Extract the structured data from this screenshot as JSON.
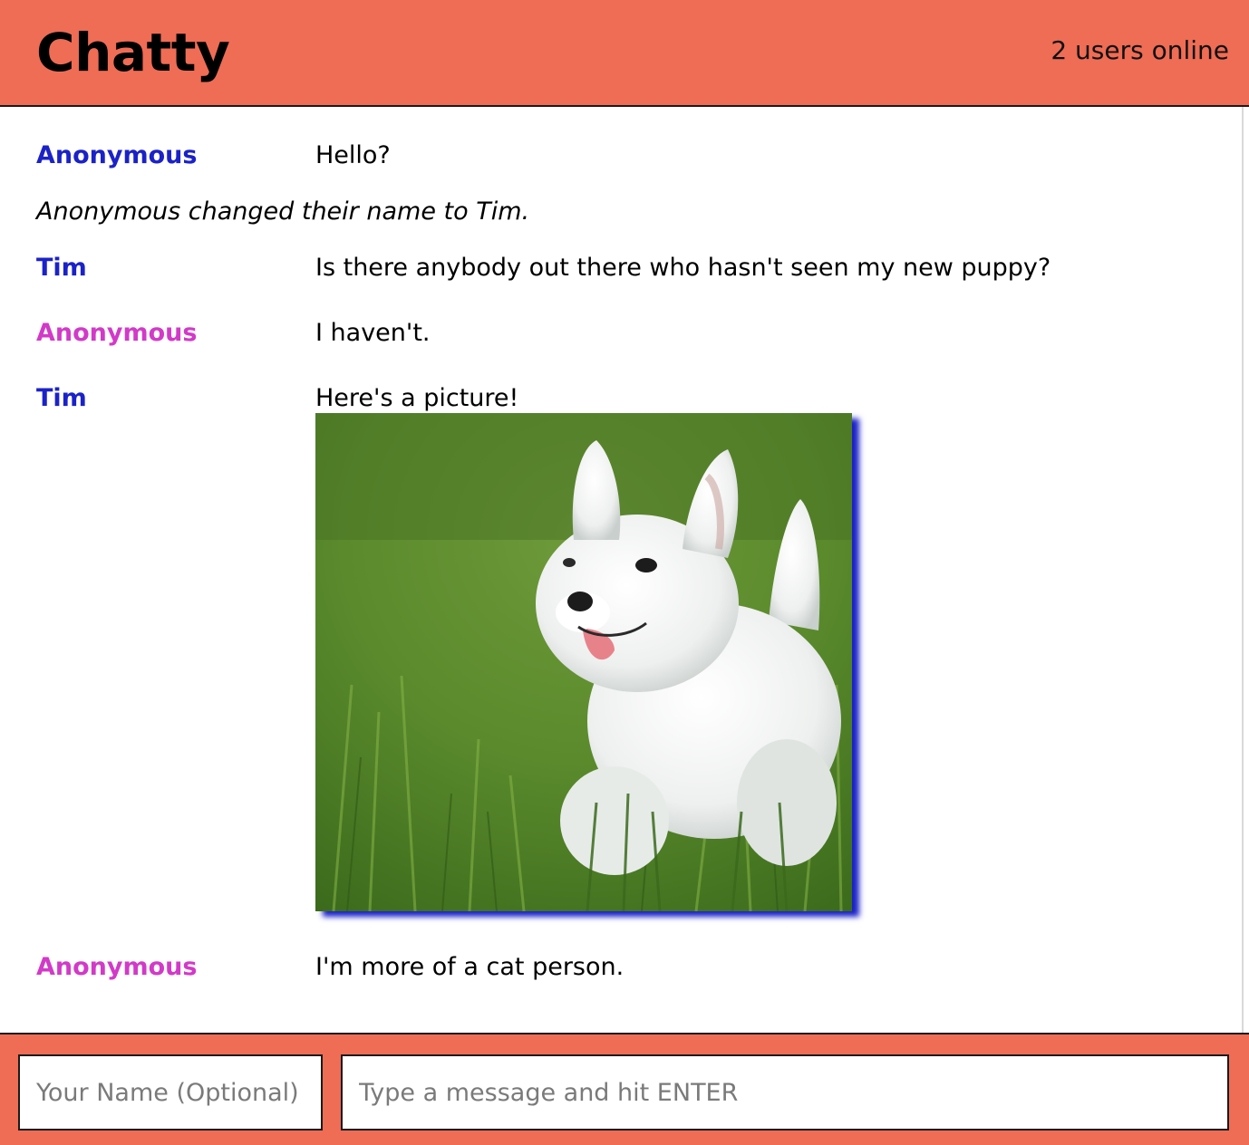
{
  "navbar": {
    "brand": "Chatty",
    "online": "2 users online"
  },
  "messages": [
    {
      "username": "Anonymous",
      "content": "Hello?"
    },
    {
      "system": "Anonymous changed their name to Tim."
    },
    {
      "username": "Tim",
      "content": "Is there anybody out there who hasn't seen my new puppy?"
    },
    {
      "username": "Anonymous",
      "content": "I haven't."
    },
    {
      "username": "Tim",
      "content": "Here's a picture!"
    },
    {
      "username": "Anonymous",
      "content": "I'm more of a cat person."
    }
  ],
  "colors": {
    "accent": "#ef6c55",
    "user_blue": "#1b22c7",
    "user_pink": "#d23ac8"
  },
  "chatbar": {
    "name_placeholder": "Your Name (Optional)",
    "message_placeholder": "Type a message and hit ENTER"
  }
}
